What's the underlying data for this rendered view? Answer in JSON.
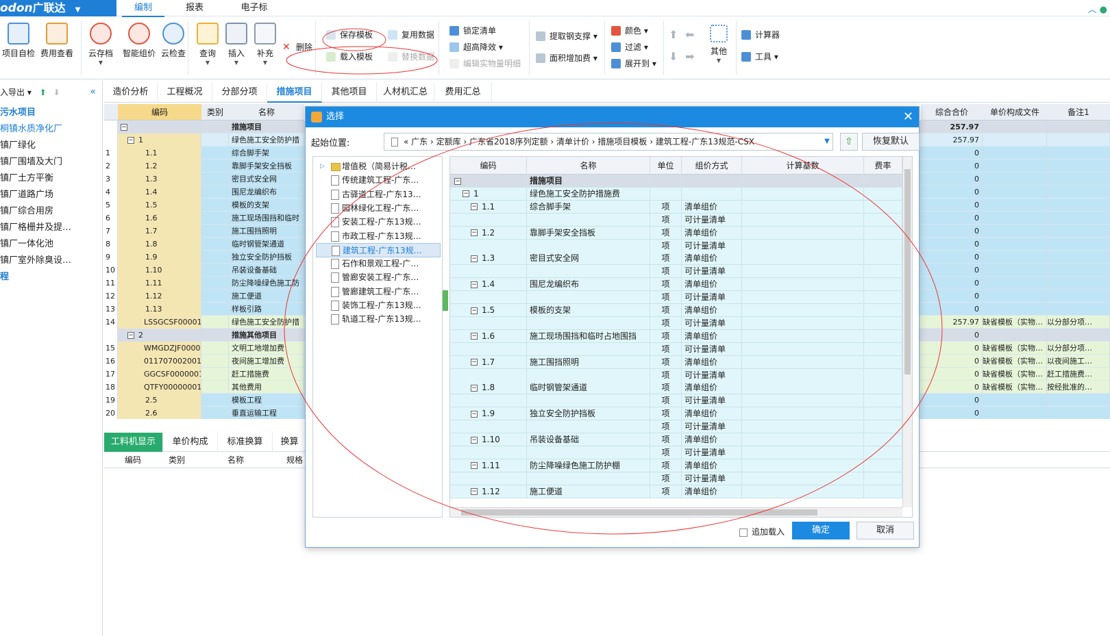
{
  "app": {
    "logo": "odon",
    "logo_cn": "广联达",
    "menu_tabs": [
      "编制",
      "报表",
      "电子标"
    ]
  },
  "ribbon": {
    "big": [
      "项目自检",
      "费用查看",
      "云存档",
      "智能组价",
      "云检查",
      "查询",
      "插入",
      "补充"
    ],
    "delete": "删除",
    "save_template": "保存模板",
    "reuse_data": "复用数据",
    "load_template": "载入模板",
    "replace_data": "替换数据",
    "lock_list": "锁定清单",
    "extract_steel": "提取钢支撑",
    "color": "颜色",
    "super_height": "超高降效",
    "filter": "过滤",
    "area_add": "面积增加费",
    "expand_to": "展开到",
    "edit_qty": "编辑实物量明细",
    "other": "其他",
    "calculator": "计算器",
    "tools": "工具"
  },
  "left": {
    "header": "入导出",
    "items": [
      "污水项目",
      "桐镇水质净化厂",
      "镇厂绿化",
      "镇厂围墙及大门",
      "镇厂土方平衡",
      "镇厂道路广场",
      "镇厂综合用房",
      "镇厂格栅井及提…",
      "镇厂一体化池",
      "镇厂室外除臭设…",
      "程"
    ]
  },
  "subtabs": [
    "造价分析",
    "工程概况",
    "分部分项",
    "措施项目",
    "其他项目",
    "人材机汇总",
    "费用汇总"
  ],
  "grid": {
    "headers": [
      "编码",
      "类别",
      "名称",
      "综合合价",
      "单价构成文件",
      "备注1"
    ],
    "rows": [
      {
        "n": "",
        "code": "",
        "name": "措施项目",
        "total": "257.97",
        "file": "",
        "note": ""
      },
      {
        "n": "",
        "code": "1",
        "name": "绿色施工安全防护措",
        "total": "257.97",
        "file": "",
        "note": ""
      },
      {
        "n": "1",
        "code": "1.1",
        "name": "综合脚手架",
        "total": "0",
        "file": "",
        "note": ""
      },
      {
        "n": "2",
        "code": "1.2",
        "name": "靠脚手架安全挡板",
        "total": "0",
        "file": "",
        "note": ""
      },
      {
        "n": "3",
        "code": "1.3",
        "name": "密目式安全网",
        "total": "0",
        "file": "",
        "note": ""
      },
      {
        "n": "4",
        "code": "1.4",
        "name": "围尼龙编织布",
        "total": "0",
        "file": "",
        "note": ""
      },
      {
        "n": "5",
        "code": "1.5",
        "name": "模板的支架",
        "total": "0",
        "file": "",
        "note": ""
      },
      {
        "n": "6",
        "code": "1.6",
        "name": "施工现场围挡和临时",
        "total": "0",
        "file": "",
        "note": ""
      },
      {
        "n": "7",
        "code": "1.7",
        "name": "施工围挡照明",
        "total": "0",
        "file": "",
        "note": ""
      },
      {
        "n": "8",
        "code": "1.8",
        "name": "临时钢管架通道",
        "total": "0",
        "file": "",
        "note": ""
      },
      {
        "n": "9",
        "code": "1.9",
        "name": "独立安全防护挡板",
        "total": "0",
        "file": "",
        "note": ""
      },
      {
        "n": "10",
        "code": "1.10",
        "name": "吊装设备基础",
        "total": "0",
        "file": "",
        "note": ""
      },
      {
        "n": "11",
        "code": "1.11",
        "name": "防尘降噪绿色施工防",
        "total": "0",
        "file": "",
        "note": ""
      },
      {
        "n": "12",
        "code": "1.12",
        "name": "施工便道",
        "total": "0",
        "file": "",
        "note": ""
      },
      {
        "n": "13",
        "code": "1.13",
        "name": "样板引路",
        "total": "0",
        "file": "",
        "note": ""
      },
      {
        "n": "14",
        "code": "LSSGCSF00001",
        "name": "绿色施工安全防护措",
        "total": "257.97",
        "file": "缺省模板（实物…",
        "note": "以分部分项…"
      },
      {
        "n": "",
        "code": "2",
        "name": "措施其他项目",
        "total": "0",
        "file": "",
        "note": ""
      },
      {
        "n": "15",
        "code": "WMGDZJF00001",
        "name": "文明工地增加费",
        "total": "0",
        "file": "缺省模板（实物…",
        "note": "以分部分项…"
      },
      {
        "n": "16",
        "code": "011707002001",
        "name": "夜间施工增加费",
        "total": "0",
        "file": "缺省模板（实物…",
        "note": "以夜间施工…"
      },
      {
        "n": "17",
        "code": "GGCSF0000001",
        "name": "赶工措施费",
        "total": "0",
        "file": "缺省模板（实物…",
        "note": "赶工措施费…"
      },
      {
        "n": "18",
        "code": "QTFY00000001",
        "name": "其他费用",
        "total": "0",
        "file": "缺省模板（实物…",
        "note": "按经批准的…"
      },
      {
        "n": "19",
        "code": "2.5",
        "name": "模板工程",
        "total": "0",
        "file": "",
        "note": ""
      },
      {
        "n": "20",
        "code": "2.6",
        "name": "垂直运输工程",
        "total": "0",
        "file": "",
        "note": ""
      }
    ]
  },
  "bottom": {
    "tabs": [
      "工料机显示",
      "单价构成",
      "标准换算",
      "换算"
    ],
    "headers": [
      "编码",
      "类别",
      "名称",
      "规格"
    ]
  },
  "dialog": {
    "title": "选择",
    "path_label": "起始位置:",
    "path": "«  广东  ›  定额库  ›  广东省2018序列定额  ›  清单计价  ›  措施项目模板  ›  建筑工程-广东13规范-CSX",
    "restore": "恢复默认",
    "tree": [
      "增值税（简易计税…",
      "传统建筑工程-广东…",
      "古驿道工程-广东13…",
      "园林绿化工程-广东…",
      "安装工程-广东13规…",
      "市政工程-广东13规…",
      "建筑工程-广东13规…",
      "石作和景观工程-广…",
      "管廊安装工程-广东…",
      "管廊建筑工程-广东…",
      "装饰工程-广东13规…",
      "轨道工程-广东13规…"
    ],
    "headers": [
      "编码",
      "名称",
      "单位",
      "组价方式",
      "计算基数",
      "费率"
    ],
    "rows": [
      {
        "code": "",
        "name": "措施项目",
        "unit": "",
        "method": ""
      },
      {
        "code": "1",
        "name": "绿色施工安全防护措施费",
        "unit": "",
        "method": ""
      },
      {
        "code": "1.1",
        "name": "综合脚手架",
        "unit": "项",
        "method": "清单组价"
      },
      {
        "code": "",
        "name": "",
        "unit": "项",
        "method": "可计量清单"
      },
      {
        "code": "1.2",
        "name": "靠脚手架安全挡板",
        "unit": "项",
        "method": "清单组价"
      },
      {
        "code": "",
        "name": "",
        "unit": "项",
        "method": "可计量清单"
      },
      {
        "code": "1.3",
        "name": "密目式安全网",
        "unit": "项",
        "method": "清单组价"
      },
      {
        "code": "",
        "name": "",
        "unit": "项",
        "method": "可计量清单"
      },
      {
        "code": "1.4",
        "name": "围尼龙编织布",
        "unit": "项",
        "method": "清单组价"
      },
      {
        "code": "",
        "name": "",
        "unit": "项",
        "method": "可计量清单"
      },
      {
        "code": "1.5",
        "name": "模板的支架",
        "unit": "项",
        "method": "清单组价"
      },
      {
        "code": "",
        "name": "",
        "unit": "项",
        "method": "可计量清单"
      },
      {
        "code": "1.6",
        "name": "施工现场围挡和临时占地围挡",
        "unit": "项",
        "method": "清单组价"
      },
      {
        "code": "",
        "name": "",
        "unit": "项",
        "method": "可计量清单"
      },
      {
        "code": "1.7",
        "name": "施工围挡照明",
        "unit": "项",
        "method": "清单组价"
      },
      {
        "code": "",
        "name": "",
        "unit": "项",
        "method": "可计量清单"
      },
      {
        "code": "1.8",
        "name": "临时钢管架通道",
        "unit": "项",
        "method": "清单组价"
      },
      {
        "code": "",
        "name": "",
        "unit": "项",
        "method": "可计量清单"
      },
      {
        "code": "1.9",
        "name": "独立安全防护挡板",
        "unit": "项",
        "method": "清单组价"
      },
      {
        "code": "",
        "name": "",
        "unit": "项",
        "method": "可计量清单"
      },
      {
        "code": "1.10",
        "name": "吊装设备基础",
        "unit": "项",
        "method": "清单组价"
      },
      {
        "code": "",
        "name": "",
        "unit": "项",
        "method": "可计量清单"
      },
      {
        "code": "1.11",
        "name": "防尘降噪绿色施工防护棚",
        "unit": "项",
        "method": "清单组价"
      },
      {
        "code": "",
        "name": "",
        "unit": "项",
        "method": "可计量清单"
      },
      {
        "code": "1.12",
        "name": "施工便道",
        "unit": "项",
        "method": "清单组价"
      }
    ],
    "append": "追加载入",
    "ok": "确定",
    "cancel": "取消"
  }
}
